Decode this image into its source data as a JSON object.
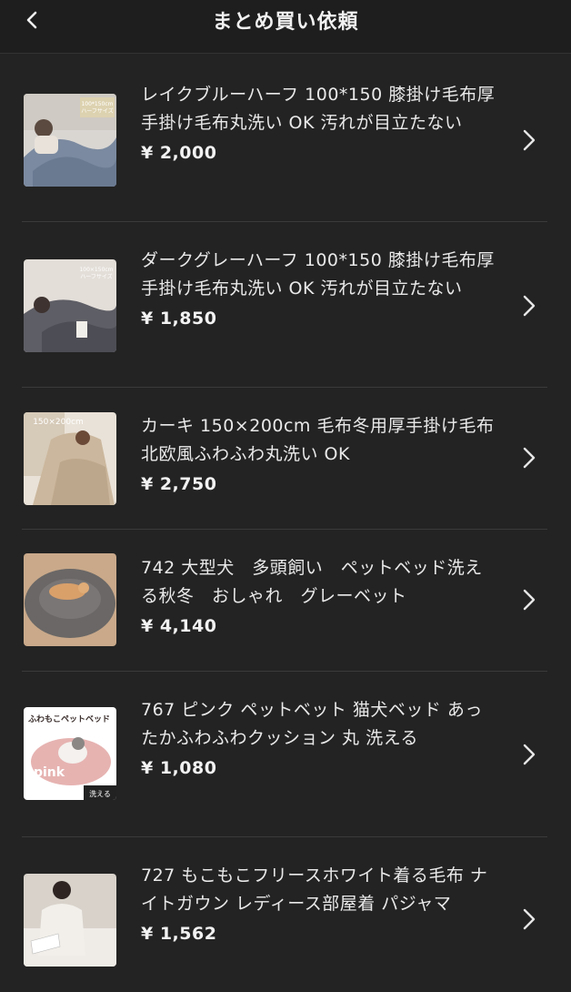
{
  "header": {
    "title": "まとめ買い依頼"
  },
  "items": [
    {
      "name": "レイクブルーハーフ 100*150 膝掛け毛布厚手掛け毛布丸洗い OK 汚れが目立たない",
      "price": "¥ 2,000",
      "thumb_text": "100*150cm ハーフサイズ",
      "color": "#6f7d92"
    },
    {
      "name": "ダークグレーハーフ 100*150 膝掛け毛布厚手掛け毛布丸洗い OK 汚れが目立たない",
      "price": "¥ 1,850",
      "thumb_text": "100*150cm ハーフサイズ",
      "color": "#5a5a60"
    },
    {
      "name": "カーキ 150×200cm 毛布冬用厚手掛け毛布北欧風ふわふわ丸洗い OK",
      "price": "¥ 2,750",
      "thumb_text": "150×200cm",
      "color": "#c8b59c"
    },
    {
      "name": "742 大型犬　多頭飼い　ペットベッド洗える秋冬　おしゃれ　グレーベット",
      "price": "¥ 4,140",
      "thumb_text": "",
      "color": "#6a6766"
    },
    {
      "name": "767 ピンク ペットベット 猫犬ベッド あったかふわふわクッション 丸 洗える",
      "price": "¥ 1,080",
      "thumb_text": "ふわもこペットベッド",
      "thumb_label": "pink",
      "thumb_badge": "洗える",
      "color": "#e6b3b1"
    },
    {
      "name": "727 もこもこフリースホワイト着る毛布 ナイトガウン レディース部屋着 パジャマ",
      "price": "¥ 1,562",
      "thumb_text": "",
      "color": "#e8e4df"
    }
  ]
}
